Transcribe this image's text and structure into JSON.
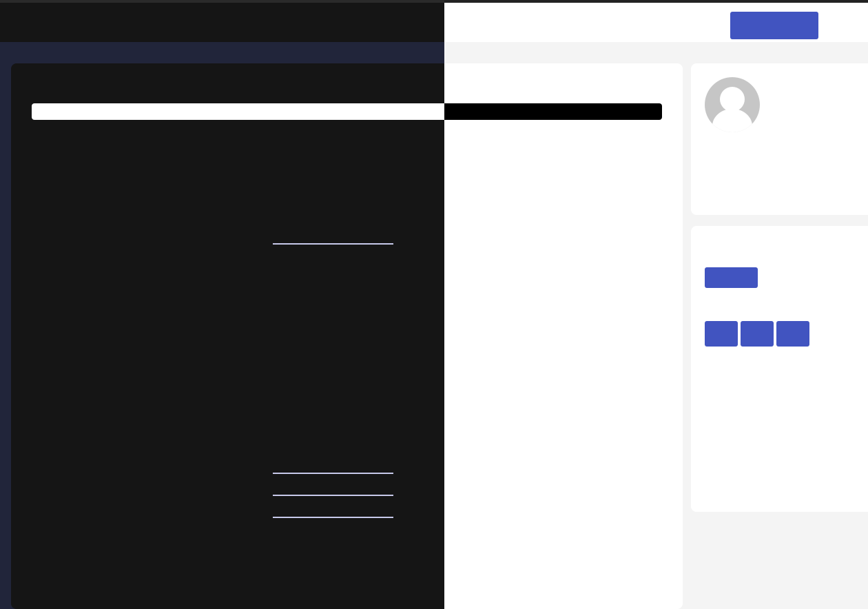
{
  "header": {
    "primary_button_label": ""
  },
  "search": {
    "placeholder": "",
    "value": ""
  },
  "main": {
    "links": [
      {
        "label": ""
      },
      {
        "label": ""
      },
      {
        "label": ""
      },
      {
        "label": ""
      }
    ]
  },
  "profile": {
    "avatar_icon": "user-avatar-icon"
  },
  "actions": {
    "primary_label": "",
    "buttons": [
      {
        "label": ""
      },
      {
        "label": ""
      },
      {
        "label": ""
      }
    ]
  },
  "colors": {
    "accent": "#4154c0",
    "link_underline": "#c7c9ea",
    "dark_surface": "#151515",
    "dark_background": "#21253a",
    "light_background": "#f4f4f4",
    "avatar_gray": "#c6c6c6"
  }
}
